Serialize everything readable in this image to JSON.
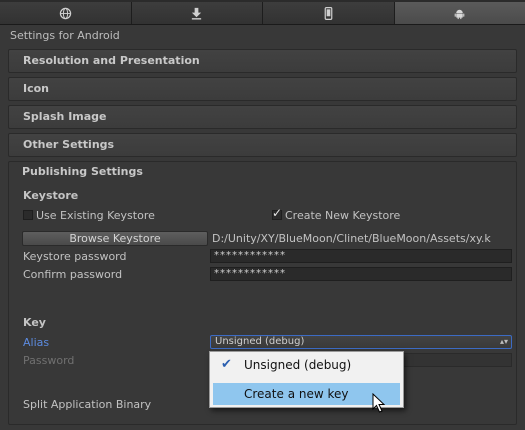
{
  "tabs": [
    {
      "icon": "globe-icon",
      "active": false
    },
    {
      "icon": "download-icon",
      "active": false
    },
    {
      "icon": "mobile-device-icon",
      "active": false
    },
    {
      "icon": "android-icon",
      "active": true
    }
  ],
  "header": {
    "settings_for": "Settings for Android"
  },
  "sections": {
    "resolution": "Resolution and Presentation",
    "icon": "Icon",
    "splash": "Splash Image",
    "other": "Other Settings",
    "publishing": "Publishing Settings"
  },
  "keystore": {
    "heading": "Keystore",
    "use_existing_label": "Use Existing Keystore",
    "use_existing_checked": false,
    "create_new_label": "Create New Keystore",
    "create_new_checked": true,
    "browse_button": "Browse Keystore",
    "path": "D:/Unity/XY/BlueMoon/Clinet/BlueMoon/Assets/xy.k",
    "password_label": "Keystore password",
    "password_value": "************",
    "confirm_label": "Confirm password",
    "confirm_value": "************"
  },
  "key": {
    "heading": "Key",
    "alias_label": "Alias",
    "alias_value": "Unsigned (debug)",
    "password_label": "Password"
  },
  "split_label": "Split Application Binary",
  "menu": {
    "items": [
      {
        "label": "Unsigned (debug)",
        "checked": true
      },
      {
        "label": "Create a new key",
        "highlighted": true
      }
    ]
  }
}
